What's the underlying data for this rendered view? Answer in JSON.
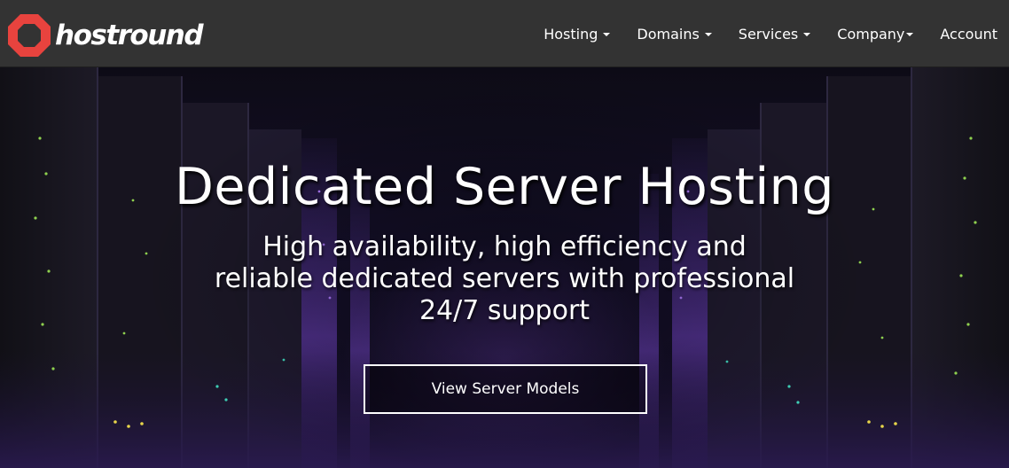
{
  "header": {
    "brand": "hostround",
    "logo_icon": "red-octagon-ring-icon",
    "brand_color": "#e8433e",
    "background": "#333333",
    "nav": [
      {
        "label": "Hosting",
        "has_dropdown": true
      },
      {
        "label": "Domains",
        "has_dropdown": true
      },
      {
        "label": "Services",
        "has_dropdown": true
      },
      {
        "label": "Company",
        "has_dropdown": true
      },
      {
        "label": "Account",
        "has_dropdown": false
      }
    ]
  },
  "hero": {
    "title": "Dedicated Server Hosting",
    "subtitle": "High availability, high efficiency and reliable dedicated servers with professional 24/7 support",
    "button_label": "View Server Models",
    "background": "server-room-image"
  }
}
